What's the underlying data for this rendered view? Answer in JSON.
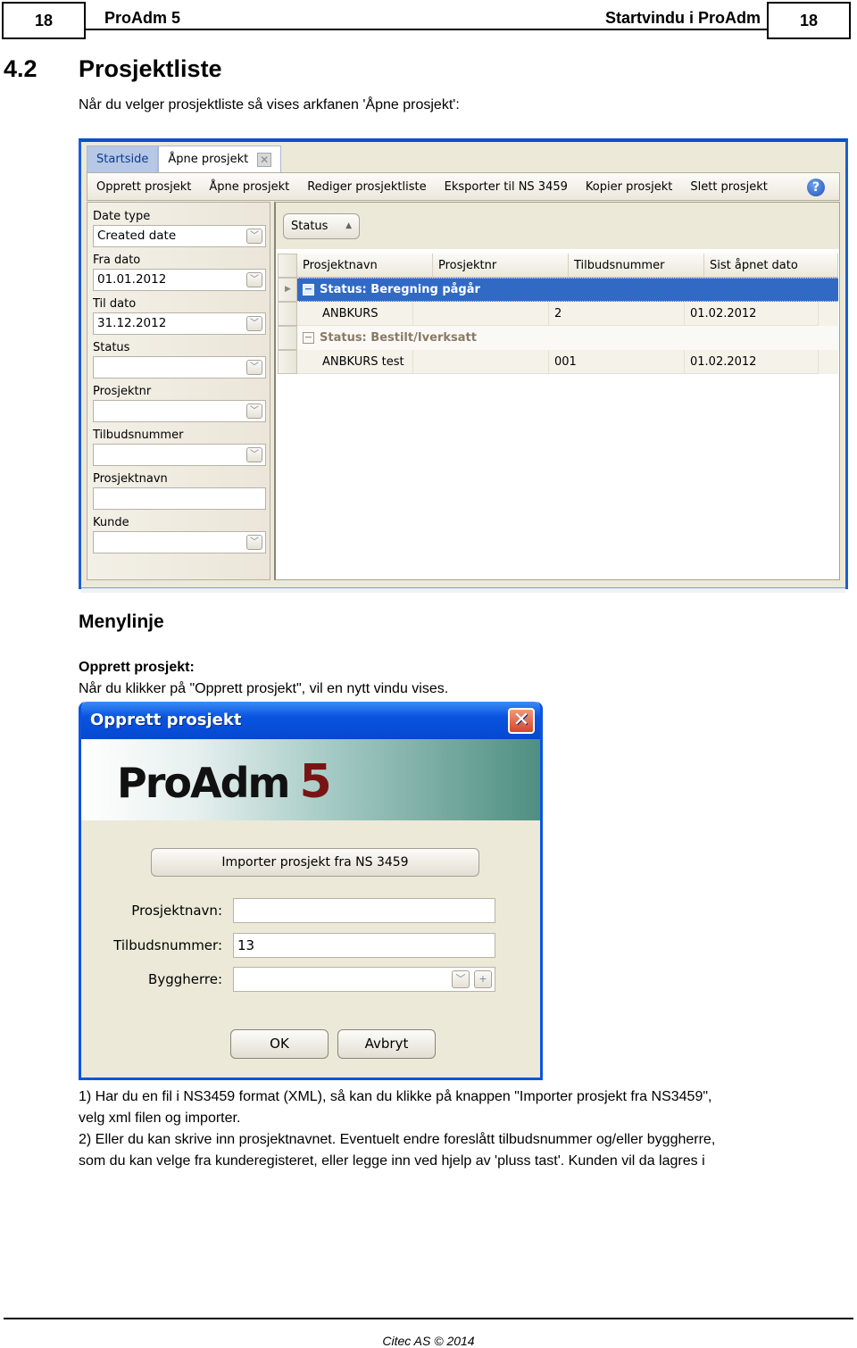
{
  "page_header": {
    "page_number_left": "18",
    "product": "ProAdm 5",
    "section": "Startvindu i ProAdm",
    "page_number_right": "18"
  },
  "heading": {
    "number": "4.2",
    "title": "Prosjektliste"
  },
  "intro": "Når du velger prosjektliste så vises arkfanen 'Åpne prosjekt':",
  "app": {
    "tabs": [
      {
        "label": "Startside",
        "active": false
      },
      {
        "label": "Åpne prosjekt",
        "active": true
      }
    ],
    "menu": [
      "Opprett prosjekt",
      "Åpne prosjekt",
      "Rediger prosjektliste",
      "Eksporter til NS 3459",
      "Kopier prosjekt",
      "Slett prosjekt"
    ],
    "help_icon": "?",
    "filters": [
      {
        "label": "Date type",
        "value": "Created date",
        "dropdown": true
      },
      {
        "label": "Fra dato",
        "value": "01.01.2012",
        "dropdown": true
      },
      {
        "label": "Til dato",
        "value": "31.12.2012",
        "dropdown": true
      },
      {
        "label": "Status",
        "value": "",
        "dropdown": true
      },
      {
        "label": "Prosjektnr",
        "value": "",
        "dropdown": true
      },
      {
        "label": "Tilbudsnummer",
        "value": "",
        "dropdown": true
      },
      {
        "label": "Prosjektnavn",
        "value": "",
        "dropdown": false
      },
      {
        "label": "Kunde",
        "value": "",
        "dropdown": true
      }
    ],
    "group_chip": "Status",
    "columns": [
      "Prosjektnavn",
      "Prosjektnr",
      "Tilbudsnummer",
      "Sist åpnet dato"
    ],
    "groups": [
      {
        "label": "Status: Beregning pågår",
        "selected": true,
        "rows": [
          {
            "prosjektnavn": "ANBKURS",
            "prosjektnr": "",
            "tilbudsnummer": "2",
            "sist_apnet": "01.02.2012"
          }
        ]
      },
      {
        "label": "Status: Bestilt/Iverksatt",
        "selected": false,
        "rows": [
          {
            "prosjektnavn": "ANBKURS test",
            "prosjektnr": "",
            "tilbudsnummer": "001",
            "sist_apnet": "01.02.2012"
          }
        ]
      }
    ]
  },
  "section_menylinje": "Menylinje",
  "opprett": {
    "heading": "Opprett prosjekt:",
    "text": "Når du klikker på \"Opprett prosjekt\", vil en nytt vindu vises."
  },
  "dialog": {
    "title": "Opprett prosjekt",
    "logo_text": "ProAdm",
    "logo_version": "5",
    "import_button": "Importer prosjekt fra NS 3459",
    "fields": {
      "prosjektnavn_label": "Prosjektnavn:",
      "prosjektnavn_value": "",
      "tilbudsnummer_label": "Tilbudsnummer:",
      "tilbudsnummer_value": "13",
      "byggherre_label": "Byggherre:",
      "byggherre_value": ""
    },
    "ok": "OK",
    "cancel": "Avbryt"
  },
  "body_lines": [
    "1) Har du en fil i NS3459 format (XML), så kan du klikke på knappen \"Importer prosjekt fra NS3459\",",
    "velg xml filen og importer.",
    "2) Eller du kan skrive inn prosjektnavnet. Eventuelt endre foreslått tilbudsnummer og/eller byggherre,",
    "som du kan velge fra kunderegisteret, eller legge inn ved hjelp av 'pluss tast'. Kunden vil da lagres i"
  ],
  "footer": "Citec AS © 2014"
}
